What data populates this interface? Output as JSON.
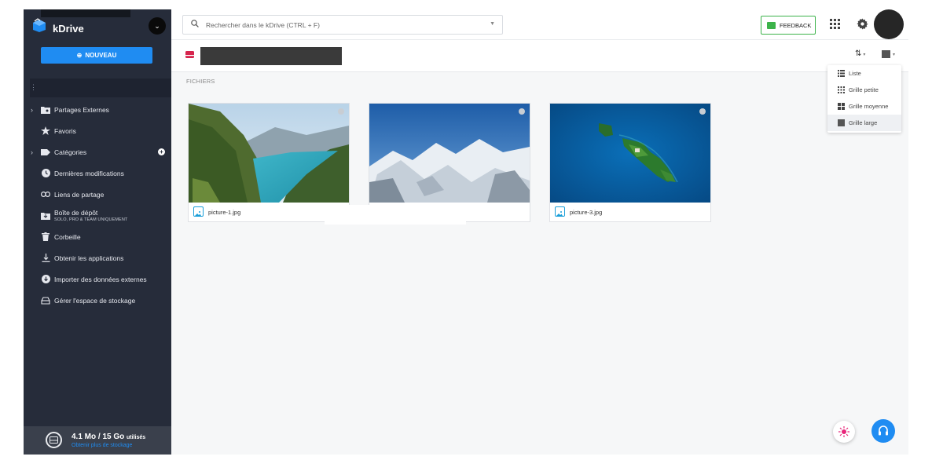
{
  "app": {
    "name": "kDrive"
  },
  "sidebar": {
    "new_button": "NOUVEAU",
    "items": [
      {
        "label": "Partages Externes",
        "icon": "shared-folder-icon",
        "expandable": true
      },
      {
        "label": "Favoris",
        "icon": "star-icon"
      },
      {
        "label": "Catégories",
        "icon": "tag-icon",
        "expandable": true
      },
      {
        "label": "Dernières modifications",
        "icon": "clock-icon"
      },
      {
        "label": "Liens de partage",
        "icon": "link-icon"
      },
      {
        "label": "Boîte de dépôt",
        "sublabel": "SOLO, PRO & TEAM UNIQUEMENT",
        "icon": "dropbox-folder-icon"
      },
      {
        "label": "Corbeille",
        "icon": "trash-icon"
      },
      {
        "label": "Obtenir les applications",
        "icon": "download-icon"
      },
      {
        "label": "Importer des données externes",
        "icon": "import-icon"
      },
      {
        "label": "Gérer l'espace de stockage",
        "icon": "storage-icon"
      }
    ],
    "storage": {
      "used": "4.1 Mo / 15 Go",
      "used_suffix": "utilisés",
      "more_link": "Obtenir plus de stockage"
    }
  },
  "header": {
    "search_placeholder": "Rechercher dans le kDrive (CTRL + F)",
    "feedback_label": "FEEDBACK"
  },
  "main": {
    "section_title": "FICHIERS",
    "files": [
      {
        "name": "picture-1.jpg",
        "icon": "image-file-icon"
      },
      {
        "name": "",
        "icon": "image-file-icon"
      },
      {
        "name": "picture-3.jpg",
        "icon": "image-file-icon"
      }
    ]
  },
  "view_menu": {
    "items": [
      {
        "label": "Liste",
        "icon": "list-view-icon"
      },
      {
        "label": "Grille petite",
        "icon": "small-grid-icon"
      },
      {
        "label": "Grille moyenne",
        "icon": "medium-grid-icon"
      },
      {
        "label": "Grille large",
        "icon": "large-grid-icon",
        "active": true
      }
    ]
  },
  "colors": {
    "sidebar": "#262c3a",
    "accent": "#1f8cf2",
    "feedback": "#3cb34a"
  }
}
